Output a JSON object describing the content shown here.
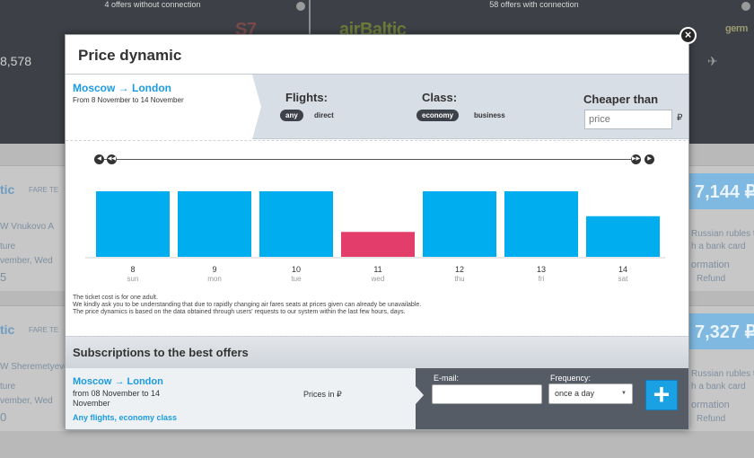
{
  "background": {
    "without_connection": "4 offers without connection",
    "with_connection": "58 offers with connection",
    "logos": [
      "S7",
      "airBaltic",
      "germ"
    ],
    "left_price": "8,578",
    "cards": [
      {
        "tag": "tic",
        "fare": "FARE TE",
        "airport": "W Vnukovo A",
        "dep": "ture",
        "date": "vember, Wed",
        "num": "5",
        "price": "7,144 ₽",
        "note1": "Russian rubles t",
        "note2": "h a bank card",
        "info": "ormation",
        "refund": "Refund"
      },
      {
        "tag": "tic",
        "fare": "FARE TE",
        "airport": "W Sheremetyevo",
        "dep": "ture",
        "date": "vember, Wed",
        "num": "0",
        "price": "7,327 ₽",
        "note1": "Russian rubles t",
        "note2": "h a bank card",
        "info": "ormation",
        "refund": "Refund"
      }
    ]
  },
  "modal": {
    "title": "Price dynamic",
    "close_icon": "close-icon",
    "route": {
      "title": "Moscow → London",
      "dates": "From 8 November to 14 November"
    },
    "flights": {
      "label": "Flights:",
      "options": [
        "any",
        "direct"
      ],
      "selected": "any"
    },
    "class": {
      "label": "Class:",
      "options": [
        "economy",
        "business"
      ],
      "selected": "economy"
    },
    "cheaper": {
      "label": "Cheaper than",
      "placeholder": "price",
      "currency": "₽"
    },
    "notes": [
      "The ticket cost is for one adult.",
      "We kindly ask you to be understanding that due to rapidly changing air fares seats at prices given can already be unavailable.",
      "The price dynamics is based on the data obtained through users' requests to our system within the last few hours, days."
    ],
    "subscriptions": {
      "title": "Subscriptions to the best offers",
      "route": "Moscow → London",
      "dates": "from 08 November to 14 November",
      "options": "Any flights, economy class",
      "prices_in": "Prices in ₽",
      "email_label": "E-mail:",
      "frequency_label": "Frequency:",
      "frequency_value": "once a day",
      "add_icon": "plus-icon"
    }
  },
  "chart_data": {
    "type": "bar",
    "categories": [
      "8 sun",
      "9 mon",
      "10 tue",
      "11 wed",
      "12 thu",
      "13 fri",
      "14 sat"
    ],
    "days": [
      "8",
      "9",
      "10",
      "11",
      "12",
      "13",
      "14"
    ],
    "weekdays": [
      "sun",
      "mon",
      "tue",
      "wed",
      "thu",
      "fri",
      "sat"
    ],
    "values": [
      1.0,
      1.0,
      1.0,
      0.38,
      1.0,
      1.0,
      0.62
    ],
    "highlight_index": 3,
    "colors": {
      "bar": "#00aeef",
      "highlight": "#e23d6b",
      "axis": "#d0d0d0"
    }
  }
}
